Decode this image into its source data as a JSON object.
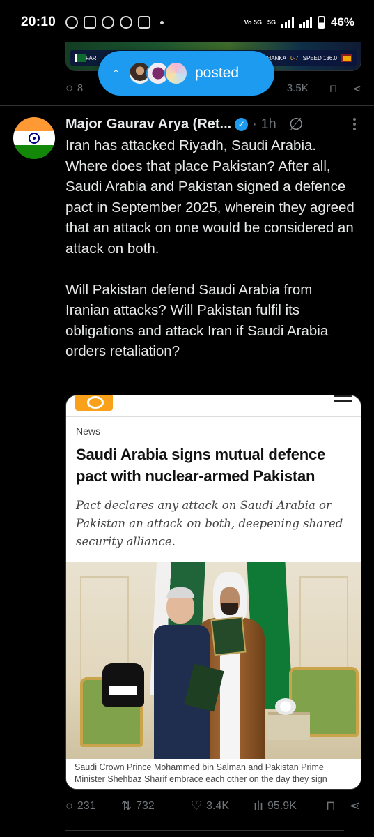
{
  "status_bar": {
    "time": "20:10",
    "network": "5G",
    "volte": "Vo 5G",
    "battery": "46%"
  },
  "previous_post": {
    "replies": "8",
    "views": "3.5K",
    "scoreboard_left": "FAR",
    "scoreboard_right": "SHANKA",
    "score": "0-7",
    "speed": "SPEED 136.0"
  },
  "new_posts_pill": {
    "arrow": "↑",
    "label": "posted"
  },
  "post": {
    "author_name": "Major Gaurav Arya (Ret...",
    "verified_mark": "✓",
    "time": "· 1h",
    "text": "Iran has attacked Riyadh, Saudi Arabia. Where does that place Pakistan? After all, Saudi Arabia and Pakistan signed a defence pact in September 2025, wherein they agreed that an attack on one would be considered an attack on both.\n\nWill Pakistan defend Saudi Arabia from Iranian attacks? Will Pakistan fulfil its obligations and attack Iran if Saudi Arabia orders retaliation?",
    "card": {
      "section": "News",
      "headline": "Saudi Arabia signs mutual defence pact with nuclear-armed Pakistan",
      "subheadline": "Pact declares any attack on Saudi Arabia or Pakistan an attack on both, deepening shared security alliance.",
      "caption": "Saudi Crown Prince Mohammed bin Salman and Pakistan Prime Minister Shehbaz Sharif embrace each other on the day they sign"
    },
    "actions": {
      "replies": "231",
      "reposts": "732",
      "likes": "3.4K",
      "views": "95.9K"
    }
  },
  "icons": [
    "whatsapp-icon",
    "instagram-icon",
    "missed-call-icon",
    "signal-bars-icon",
    "battery-icon",
    "verified-badge-icon",
    "grok-icon",
    "more-icon",
    "reply-icon",
    "repost-icon",
    "like-icon",
    "views-icon",
    "bookmark-icon",
    "share-icon"
  ],
  "colors": {
    "accent": "#1d9bf0",
    "background": "#000000",
    "text": "#e7e9ea",
    "muted": "#71767b"
  }
}
